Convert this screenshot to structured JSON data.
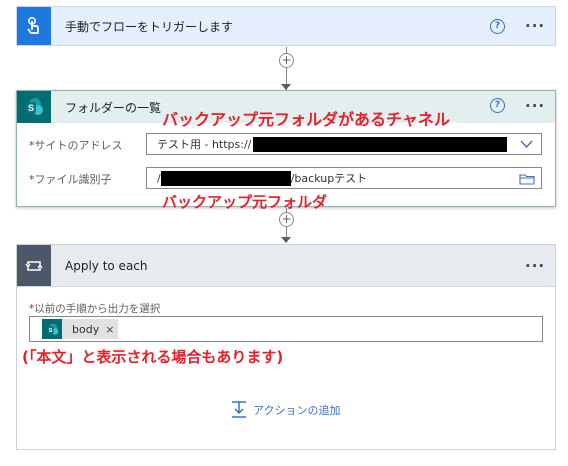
{
  "trigger": {
    "title": "手動でフローをトリガーします",
    "help": "?",
    "more": "···"
  },
  "folder_card": {
    "title": "フォルダーの一覧",
    "help": "?",
    "more": "···",
    "site_label": "サイトのアドレス",
    "site_value": "テスト用 - https://",
    "file_label": "ファイル識別子",
    "file_prefix": "/",
    "file_suffix": "/backupテスト",
    "required_mark": "*"
  },
  "apply_card": {
    "title": "Apply to each",
    "more": "···",
    "output_label": "以前の手順から出力を選択",
    "required_mark": "*",
    "token_label": "body",
    "token_close": "×",
    "add_action_label": "アクションの追加"
  },
  "connector": {
    "plus": "+"
  },
  "annotations": {
    "channel": "バックアップ元フォルダがあるチャネル",
    "folder": "バックアップ元フォルダ",
    "note": "(「本文」と表示される場合もあります)"
  },
  "colors": {
    "trigger_blue": "#0a6dd9",
    "sharepoint_teal": "#036c70",
    "loop_gray": "#4c5869",
    "annotation_red": "#e8202a"
  }
}
